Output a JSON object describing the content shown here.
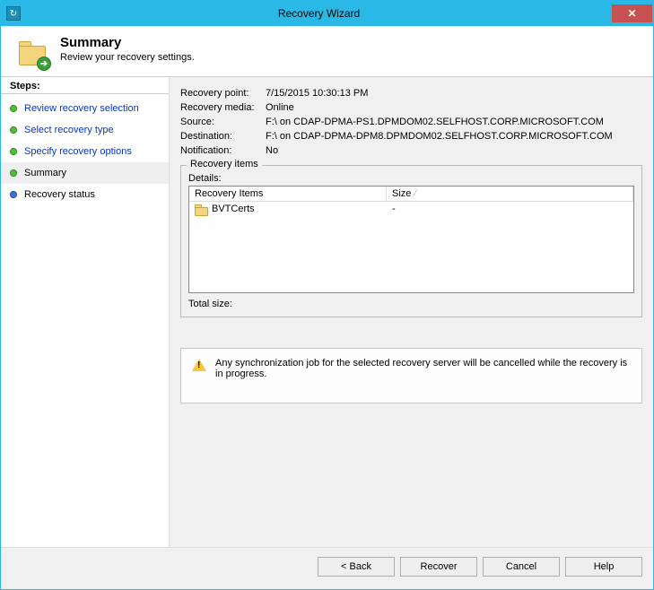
{
  "window": {
    "title": "Recovery Wizard"
  },
  "header": {
    "title": "Summary",
    "subtitle": "Review your recovery settings."
  },
  "nav": {
    "title": "Steps:",
    "items": [
      {
        "label": "Review recovery selection",
        "state": "done",
        "link": true
      },
      {
        "label": "Select recovery type",
        "state": "done",
        "link": true
      },
      {
        "label": "Specify recovery options",
        "state": "done",
        "link": true
      },
      {
        "label": "Summary",
        "state": "current",
        "link": false
      },
      {
        "label": "Recovery status",
        "state": "pending",
        "link": false
      }
    ]
  },
  "summary": {
    "recovery_point": {
      "label": "Recovery point:",
      "value": "7/15/2015 10:30:13 PM"
    },
    "recovery_media": {
      "label": "Recovery media:",
      "value": "Online"
    },
    "source": {
      "label": "Source:",
      "value": "F:\\ on CDAP-DPMA-PS1.DPMDOM02.SELFHOST.CORP.MICROSOFT.COM"
    },
    "destination": {
      "label": "Destination:",
      "value": "F:\\ on CDAP-DPMA-DPM8.DPMDOM02.SELFHOST.CORP.MICROSOFT.COM"
    },
    "notification": {
      "label": "Notification:",
      "value": "No"
    }
  },
  "recovery_items": {
    "legend": "Recovery items",
    "details_label": "Details:",
    "columns": {
      "name": "Recovery Items",
      "size": "Size"
    },
    "rows": [
      {
        "name": "BVTCerts",
        "size": "-"
      }
    ],
    "total_label": "Total size:",
    "total_value": ""
  },
  "warning": {
    "text": "Any synchronization job for the selected recovery server will be cancelled while the recovery is in progress."
  },
  "buttons": {
    "back": "< Back",
    "recover": "Recover",
    "cancel": "Cancel",
    "help": "Help"
  }
}
